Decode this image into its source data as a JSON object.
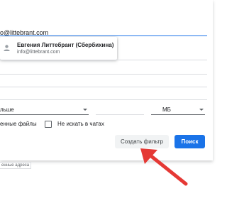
{
  "from_field": {
    "value": "o@littebrant.com"
  },
  "suggestion": {
    "name": "Евгения Литтебрант (Сбербихина)",
    "email": "info@littebrant.com",
    "avatar_icon": "person-icon"
  },
  "size": {
    "operator": "льше",
    "value": "",
    "unit": "МБ"
  },
  "checkboxes": {
    "has_attachment_label": "енные файлы",
    "no_chats_label": "Не искать в чатах",
    "no_chats_checked": false
  },
  "buttons": {
    "create_filter": "Создать фильтр",
    "search": "Поиск"
  },
  "footnote": "енные адреса",
  "colors": {
    "accent": "#1a73e8",
    "arrow": "#e53935"
  }
}
